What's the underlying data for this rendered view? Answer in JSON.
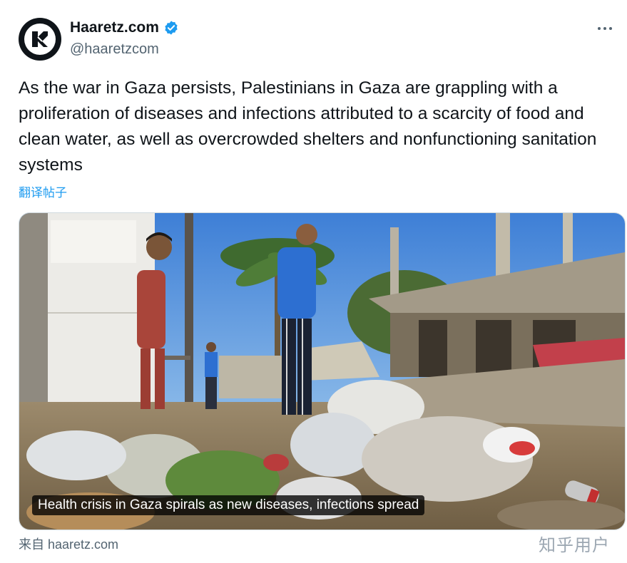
{
  "account": {
    "display_name": "Haaretz.com",
    "handle": "@haaretzcom",
    "logo_icon": "haaretz-logo-icon",
    "verified_icon": "verified-badge-icon",
    "verified_color": "#1d9bf0"
  },
  "tweet": {
    "text": "As the war in Gaza persists, Palestinians in Gaza are grappling with a proliferation of diseases and infections attributed to a scarcity of food and clean water, as well as overcrowded shelters and nonfunctioning sanitation systems",
    "translate_label": "翻译帖子"
  },
  "card": {
    "title": "Health crisis in Gaza spirals as new diseases, infections spread",
    "source": "来自 haaretz.com"
  },
  "watermark": "知乎用户",
  "more_icon": "more-options-icon"
}
